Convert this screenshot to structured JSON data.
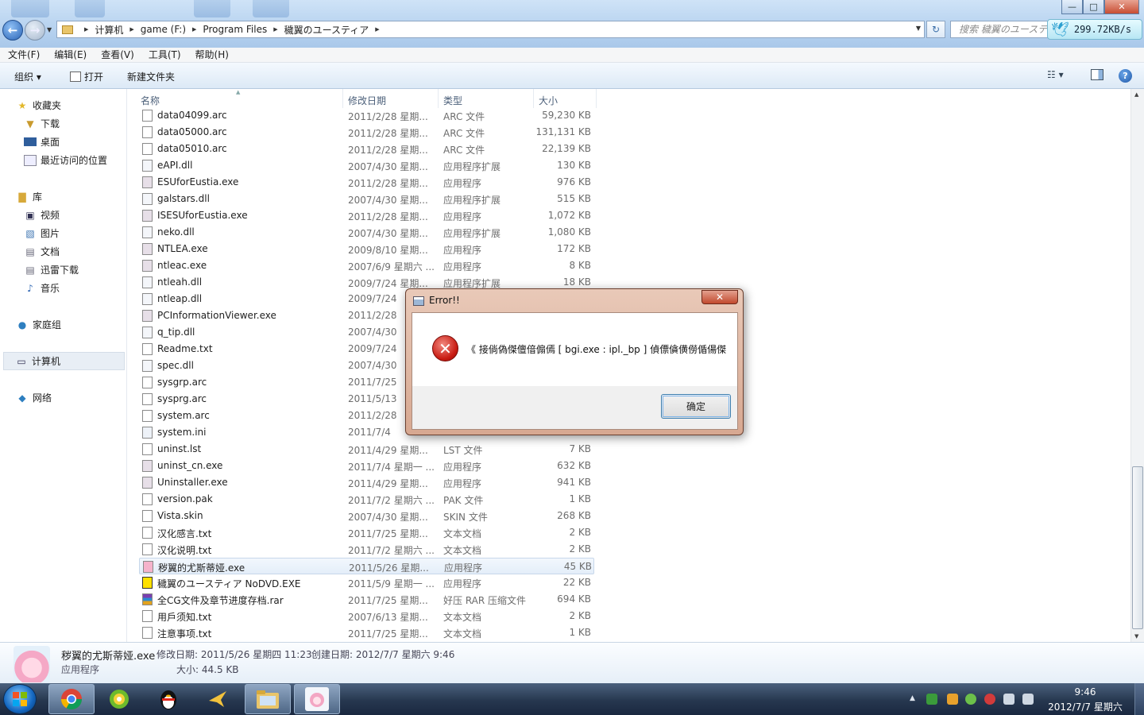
{
  "window": {
    "controls": {
      "minimize": "—",
      "maximize": "□",
      "close": "✕"
    }
  },
  "address": {
    "crumbs": [
      "计算机",
      "game (F:)",
      "Program Files",
      "穢翼のユースティア"
    ],
    "search_placeholder": "搜索 穢翼のユースティ",
    "net_speed": "299.72KB/s"
  },
  "menu": [
    "文件(F)",
    "编辑(E)",
    "查看(V)",
    "工具(T)",
    "帮助(H)"
  ],
  "toolbar": {
    "organize": "组织 ▾",
    "open": "打开",
    "new_folder": "新建文件夹",
    "view": "☷ ▾",
    "help": "?"
  },
  "nav": {
    "favorites": "收藏夹",
    "downloads": "下载",
    "desktop": "桌面",
    "recent": "最近访问的位置",
    "libraries": "库",
    "videos": "视频",
    "pictures": "图片",
    "documents": "文档",
    "thunder": "迅雷下载",
    "music": "音乐",
    "homegroup": "家庭组",
    "computer": "计算机",
    "network": "网络"
  },
  "columns": {
    "name": "名称",
    "date": "修改日期",
    "type": "类型",
    "size": "大小"
  },
  "files": [
    {
      "name": "data04099.arc",
      "date": "2011/2/28 星期...",
      "type": "ARC 文件",
      "size": "59,230 KB",
      "icon": "file-icon"
    },
    {
      "name": "data05000.arc",
      "date": "2011/2/28 星期...",
      "type": "ARC 文件",
      "size": "131,131 KB",
      "icon": "file-icon"
    },
    {
      "name": "data05010.arc",
      "date": "2011/2/28 星期...",
      "type": "ARC 文件",
      "size": "22,139 KB",
      "icon": "file-icon"
    },
    {
      "name": "eAPI.dll",
      "date": "2007/4/30 星期...",
      "type": "应用程序扩展",
      "size": "130 KB",
      "icon": "dll-icon"
    },
    {
      "name": "ESUforEustia.exe",
      "date": "2011/2/28 星期...",
      "type": "应用程序",
      "size": "976 KB",
      "icon": "app-icon"
    },
    {
      "name": "galstars.dll",
      "date": "2007/4/30 星期...",
      "type": "应用程序扩展",
      "size": "515 KB",
      "icon": "dll-icon"
    },
    {
      "name": "ISESUforEustia.exe",
      "date": "2011/2/28 星期...",
      "type": "应用程序",
      "size": "1,072 KB",
      "icon": "app-icon"
    },
    {
      "name": "neko.dll",
      "date": "2007/4/30 星期...",
      "type": "应用程序扩展",
      "size": "1,080 KB",
      "icon": "dll-icon"
    },
    {
      "name": "NTLEA.exe",
      "date": "2009/8/10 星期...",
      "type": "应用程序",
      "size": "172 KB",
      "icon": "app-icon"
    },
    {
      "name": "ntleac.exe",
      "date": "2007/6/9 星期六 ...",
      "type": "应用程序",
      "size": "8 KB",
      "icon": "app-icon"
    },
    {
      "name": "ntleah.dll",
      "date": "2009/7/24 星期...",
      "type": "应用程序扩展",
      "size": "18 KB",
      "icon": "dll-icon"
    },
    {
      "name": "ntleap.dll",
      "date": "2009/7/24",
      "type": "",
      "size": "",
      "icon": "dll-icon"
    },
    {
      "name": "PCInformationViewer.exe",
      "date": "2011/2/28",
      "type": "",
      "size": "",
      "icon": "app-icon"
    },
    {
      "name": "q_tip.dll",
      "date": "2007/4/30",
      "type": "",
      "size": "",
      "icon": "dll-icon"
    },
    {
      "name": "Readme.txt",
      "date": "2009/7/24",
      "type": "",
      "size": "",
      "icon": "text-icon"
    },
    {
      "name": "spec.dll",
      "date": "2007/4/30",
      "type": "",
      "size": "",
      "icon": "dll-icon"
    },
    {
      "name": "sysgrp.arc",
      "date": "2011/7/25",
      "type": "",
      "size": "",
      "icon": "file-icon"
    },
    {
      "name": "sysprg.arc",
      "date": "2011/5/13",
      "type": "",
      "size": "",
      "icon": "file-icon"
    },
    {
      "name": "system.arc",
      "date": "2011/2/28",
      "type": "",
      "size": "",
      "icon": "file-icon"
    },
    {
      "name": "system.ini",
      "date": "2011/7/4",
      "type": "",
      "size": "",
      "icon": "ini-icon"
    },
    {
      "name": "uninst.lst",
      "date": "2011/4/29 星期...",
      "type": "LST 文件",
      "size": "7 KB",
      "icon": "file-icon"
    },
    {
      "name": "uninst_cn.exe",
      "date": "2011/7/4 星期一 ...",
      "type": "应用程序",
      "size": "632 KB",
      "icon": "app-icon"
    },
    {
      "name": "Uninstaller.exe",
      "date": "2011/4/29 星期...",
      "type": "应用程序",
      "size": "941 KB",
      "icon": "app-icon"
    },
    {
      "name": "version.pak",
      "date": "2011/7/2 星期六 ...",
      "type": "PAK 文件",
      "size": "1 KB",
      "icon": "file-icon"
    },
    {
      "name": "Vista.skin",
      "date": "2007/4/30 星期...",
      "type": "SKIN 文件",
      "size": "268 KB",
      "icon": "file-icon"
    },
    {
      "name": "汉化感言.txt",
      "date": "2011/7/25 星期...",
      "type": "文本文档",
      "size": "2 KB",
      "icon": "text-icon"
    },
    {
      "name": "汉化说明.txt",
      "date": "2011/7/2 星期六 ...",
      "type": "文本文档",
      "size": "2 KB",
      "icon": "text-icon"
    },
    {
      "name": "秽翼的尤斯蒂娅.exe",
      "date": "2011/5/26 星期...",
      "type": "应用程序",
      "size": "45 KB",
      "icon": "game-icon",
      "selected": true
    },
    {
      "name": "穢翼のユースティア NoDVD.EXE",
      "date": "2011/5/9 星期一 ...",
      "type": "应用程序",
      "size": "22 KB",
      "icon": "nodvd-icon"
    },
    {
      "name": "全CG文件及章节进度存档.rar",
      "date": "2011/7/25 星期...",
      "type": "好压 RAR 压缩文件",
      "size": "694 KB",
      "icon": "rar-icon"
    },
    {
      "name": "用戶须知.txt",
      "date": "2007/6/13 星期...",
      "type": "文本文档",
      "size": "2 KB",
      "icon": "text-icon"
    },
    {
      "name": "注意事项.txt",
      "date": "2011/7/25 星期...",
      "type": "文本文档",
      "size": "1 KB",
      "icon": "text-icon"
    }
  ],
  "details": {
    "name": "秽翼的尤斯蒂娅.exe",
    "modified": "修改日期: 2011/5/26 星期四 11:23",
    "created": "创建日期: 2012/7/7 星期六 9:46",
    "type": "应用程序",
    "size": "大小: 44.5 KB"
  },
  "dialog": {
    "title": "Error!!",
    "close": "✕",
    "message": "《 接倘偽傑儃偣傓傿 [ bgi.exe : ipl._bp ] 偵僄僋僙僗偱偒傑",
    "ok": "确定"
  },
  "taskbar": {
    "time": "9:46",
    "date": "2012/7/7 星期六"
  },
  "colors": {
    "accent": "#2a64b6",
    "error": "#c81b12",
    "selection": "#e4eef9"
  }
}
